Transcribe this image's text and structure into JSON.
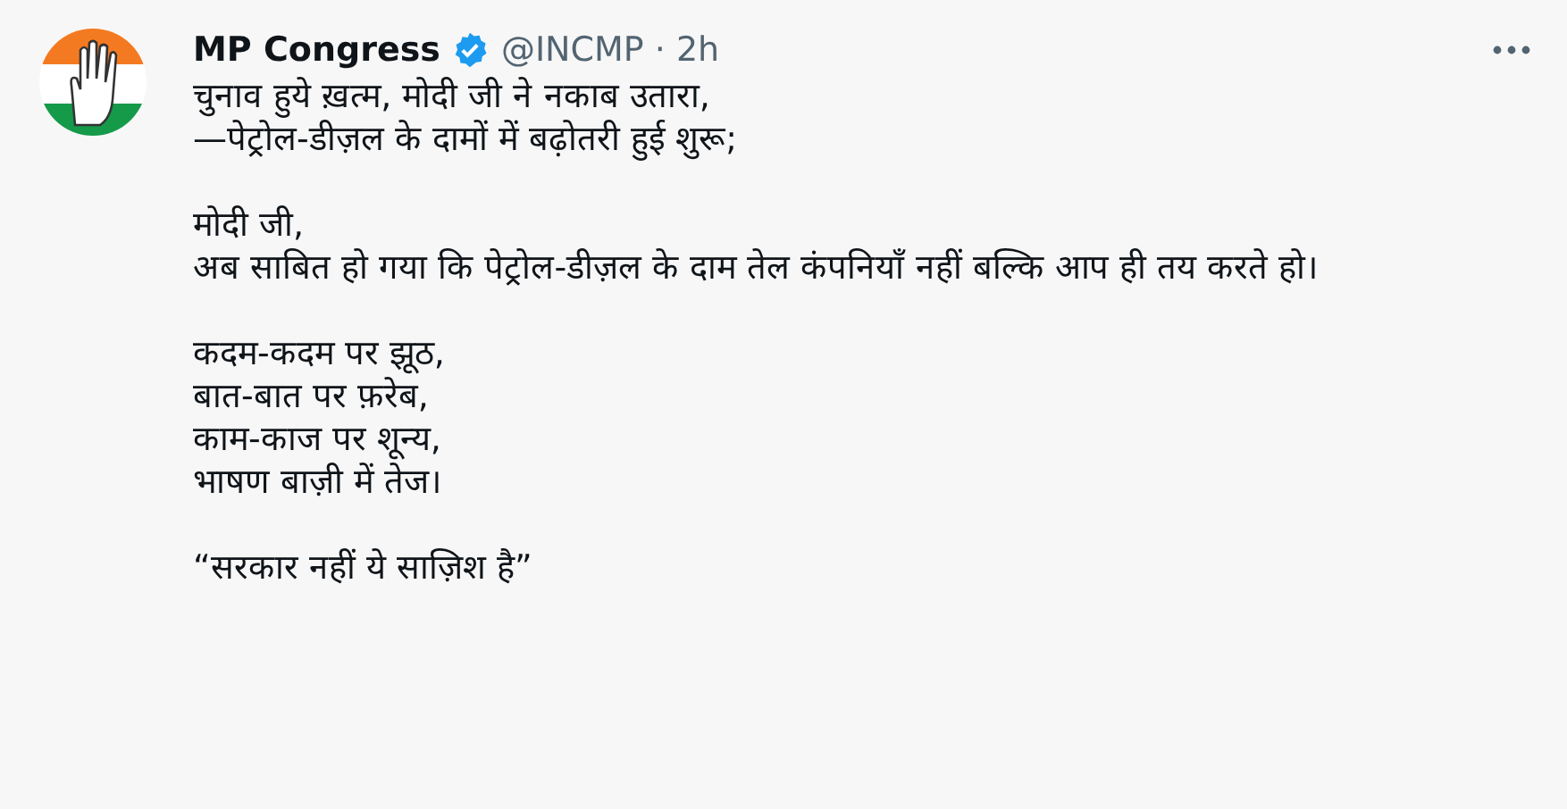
{
  "tweet": {
    "display_name": "MP Congress",
    "verified": true,
    "handle": "@INCMP",
    "separator": "·",
    "time": "2h",
    "paragraphs": [
      [
        "चुनाव हुये ख़त्म, मोदी जी ने नकाब उतारा,",
        "—पेट्रोल-डीज़ल के दामों में बढ़ोतरी हुई शुरू;"
      ],
      [
        "मोदी जी,",
        "अब साबित हो गया कि पेट्रोल-डीज़ल के दाम तेल कंपनियाँ नहीं बल्कि आप ही तय करते हो।"
      ],
      [
        "कदम-कदम पर झूठ,",
        "बात-बात पर फ़रेब,",
        "काम-काज पर शून्य,",
        "भाषण बाज़ी में तेज।"
      ],
      [
        "“सरकार नहीं ये साज़िश है”"
      ]
    ]
  }
}
